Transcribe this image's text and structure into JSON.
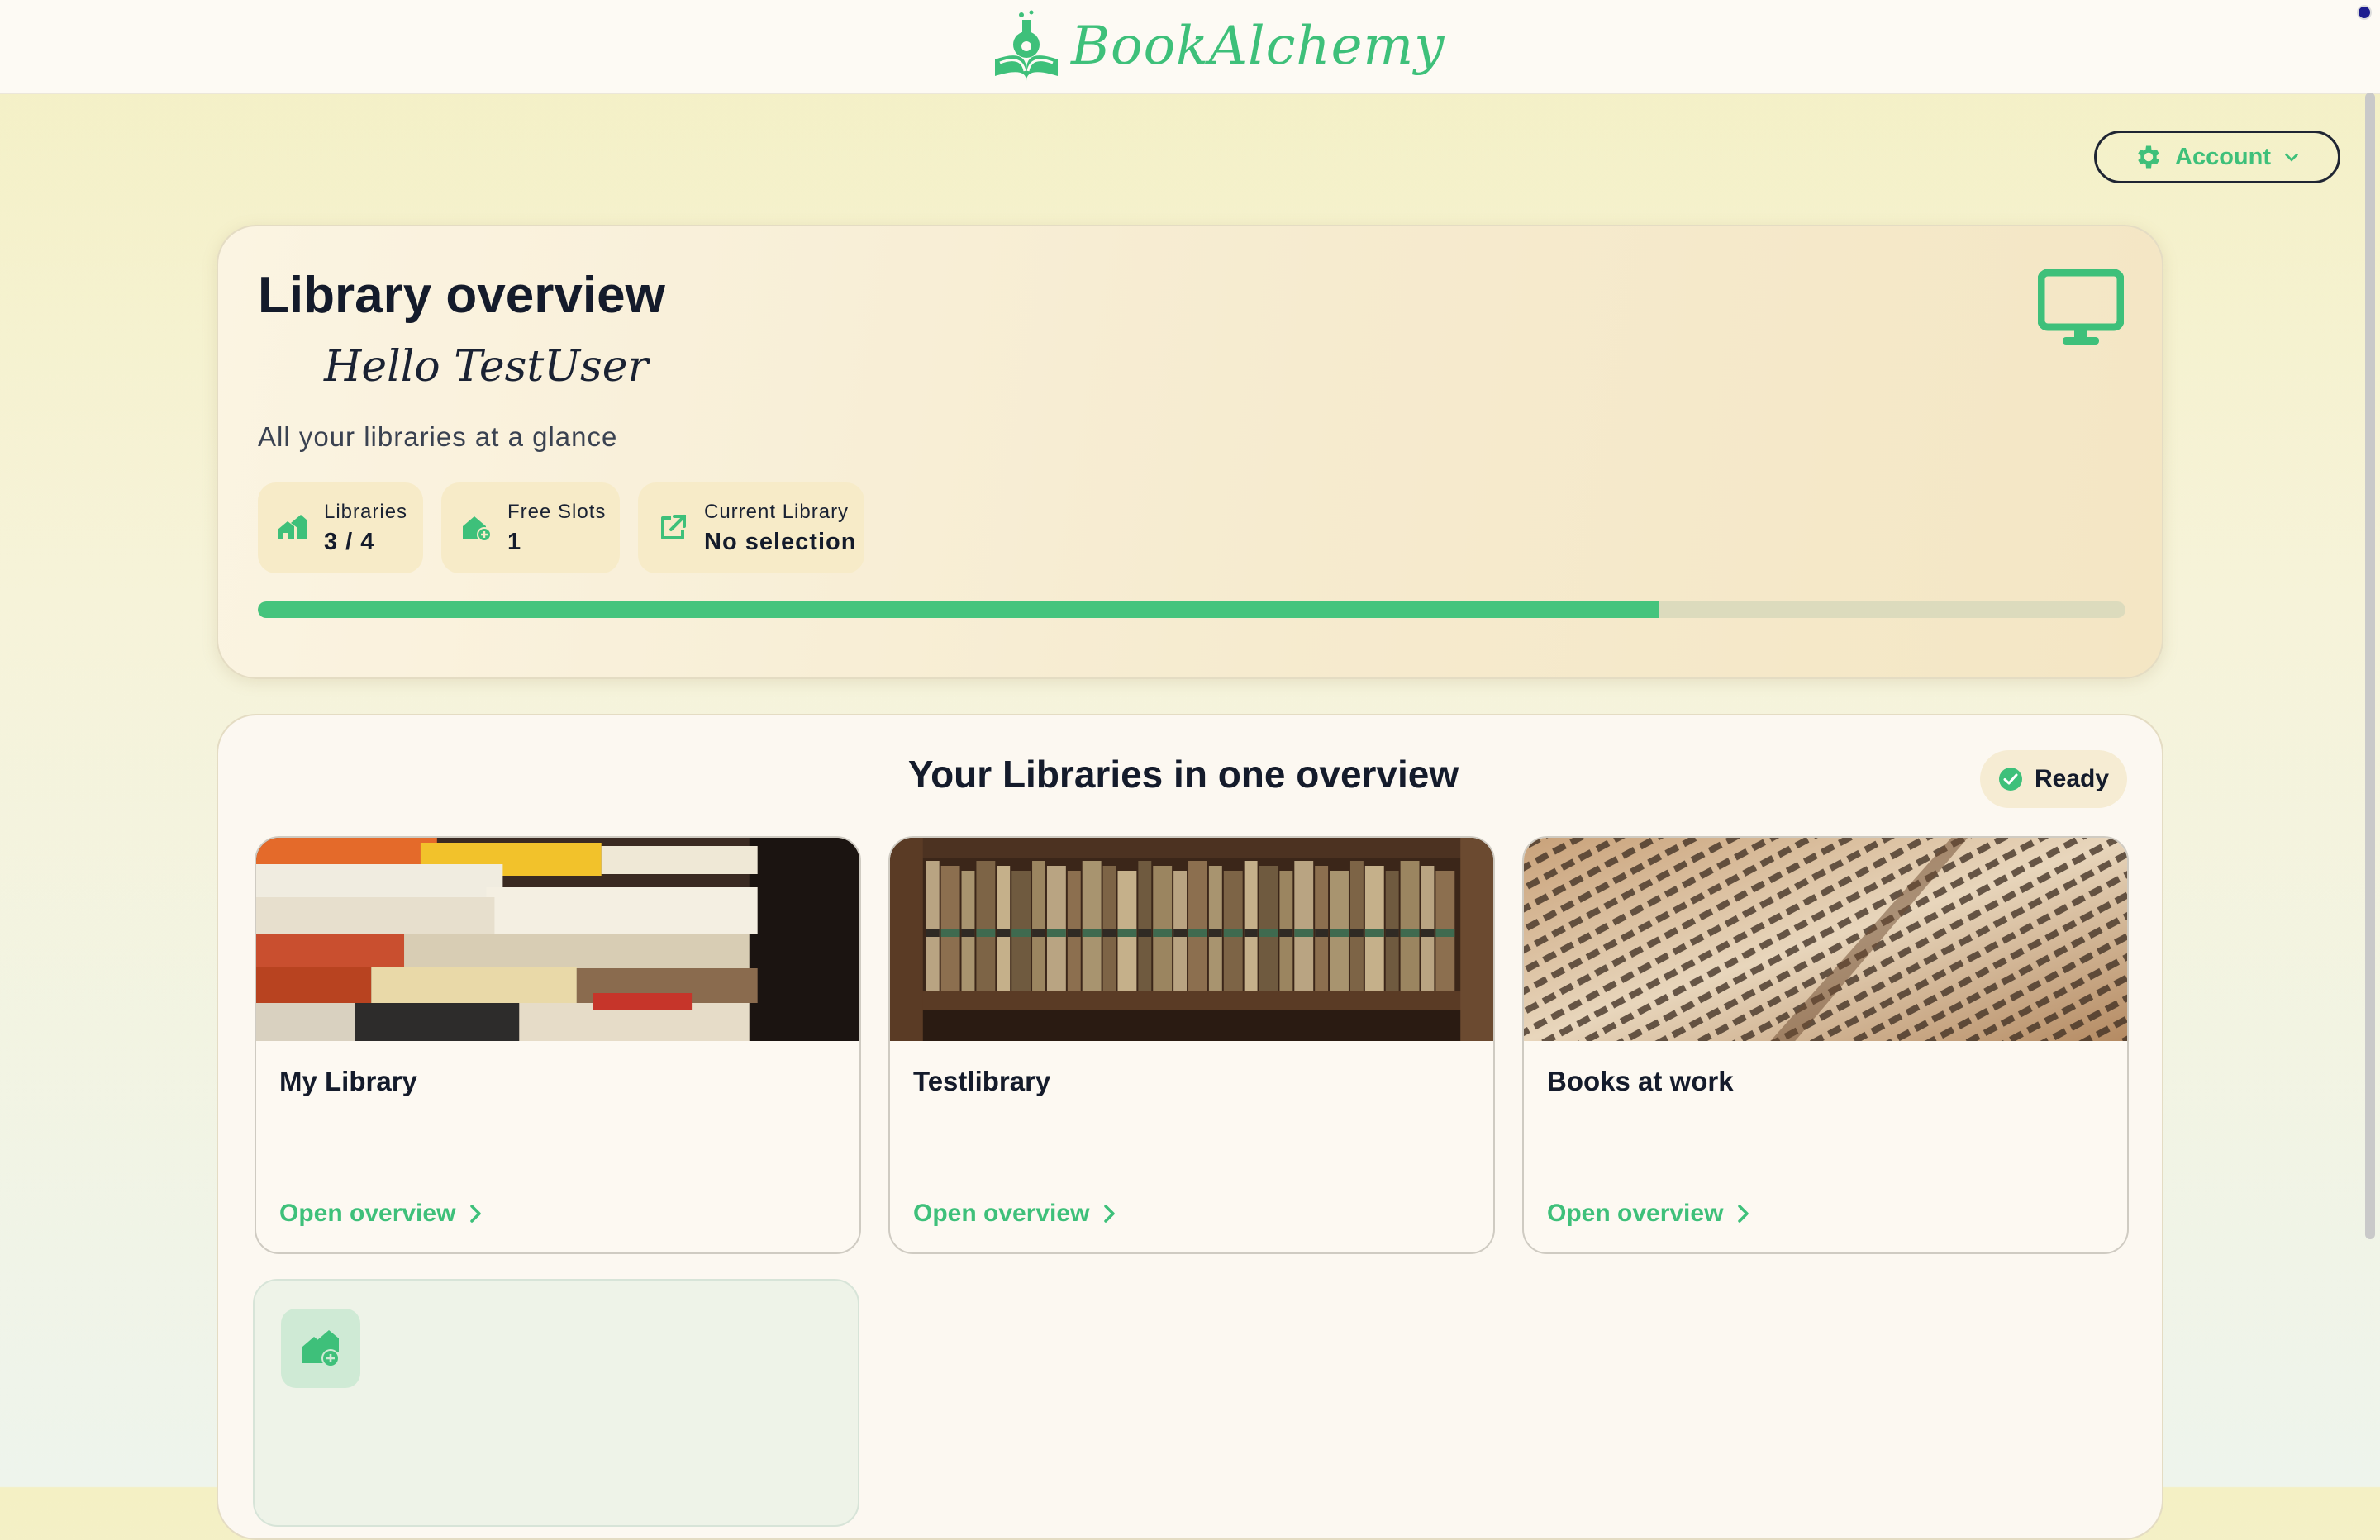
{
  "header": {
    "brand": "BookAlchemy"
  },
  "account": {
    "label": "Account"
  },
  "overview": {
    "title": "Library overview",
    "greeting": "Hello TestUser",
    "subtitle": "All your libraries at a glance",
    "stats": [
      {
        "label": "Libraries",
        "value": "3 / 4"
      },
      {
        "label": "Free Slots",
        "value": "1"
      },
      {
        "label": "Current Library",
        "value": "No selection"
      }
    ],
    "progress_fraction": 0.75
  },
  "libraries": {
    "title": "Your Libraries in one overview",
    "status": "Ready",
    "items": [
      {
        "name": "My Library",
        "link": "Open overview"
      },
      {
        "name": "Testlibrary",
        "link": "Open overview"
      },
      {
        "name": "Books at work",
        "link": "Open overview"
      }
    ]
  },
  "colors": {
    "accent": "#3ec07a",
    "progress_track": "#dcdbbd",
    "card_bg": "#fcf8f1"
  },
  "icons": [
    "book-alchemy-logo-icon",
    "gear-icon",
    "chevron-down-icon",
    "monitor-icon",
    "houses-icon",
    "house-plus-icon",
    "external-link-icon",
    "check-circle-icon",
    "chevron-right-icon",
    "add-library-icon"
  ]
}
